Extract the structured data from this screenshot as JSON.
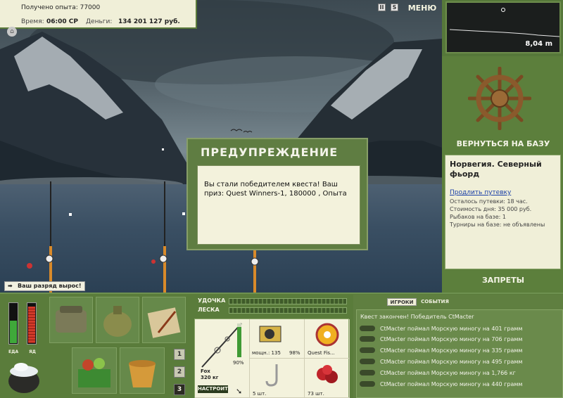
{
  "info": {
    "experience_text": "Получено опыта: 77000",
    "time_label": "Время:",
    "time_value": "06:00 СР",
    "money_label": "Деньги:",
    "money_value": "134 201 127 руб."
  },
  "top_controls": {
    "pause_label": "II",
    "sound_label": "S",
    "menu_label": "МЕНЮ"
  },
  "depth_meter": {
    "depth": "8,04 m"
  },
  "right_panel": {
    "return_label": "ВЕРНУТЬСЯ НА БАЗУ",
    "location_title": "Норвегия. Северный фьорд",
    "extend_link": "Продлить путевку",
    "lines": [
      "Осталось путевки: 18 час.",
      "Стоимость дня: 35 000 руб.",
      "Рыбаков на базе: 1",
      "Турниры на базе: не объявлены"
    ],
    "bans_label": "ЗАПРЕТЫ"
  },
  "dialog": {
    "title": "ПРЕДУПРЕЖДЕНИЕ",
    "message": "Вы стали победителем квеста! Ваш приз: Quest Winners-1, 180000 , Опыта"
  },
  "rank_notice": "Ваш разряд вырос!",
  "gauges": {
    "food_label": "ЕДА",
    "poison_label": "ЯД",
    "food_level": 0.55,
    "poison_level": 0.9
  },
  "inventory_pages": [
    "1",
    "2",
    "3"
  ],
  "tackle": {
    "rod_label": "УДОЧКА",
    "line_label": "ЛЕСКА",
    "rod_name": "Fox",
    "rod_capacity": "320 кг",
    "rod_percent": "90%",
    "reel_text": "мощн.: 135",
    "reel_percent": "98%",
    "line_name": "Quest Fis...",
    "hook_count": "5 шт.",
    "bait_count": "73 шт.",
    "setup_label": "НАСТРОИТЬ"
  },
  "chat": {
    "tab_players": "ИГРОКИ",
    "tab_events": "СОБЫТИЯ",
    "header": "Квест закончен! Победитель CtMacter",
    "messages": [
      "CtMacter поймал Морскую миногу на 401 грамм",
      "CtMacter поймал Морскую миногу на 706 грамм",
      "CtMacter поймал Морскую миногу на 335 грамм",
      "CtMacter поймал Морскую миногу на 495 грамм",
      "CtMacter поймал Морскую миногу на 1,766 кг",
      "CtMacter поймал Морскую миногу на 440 грамм"
    ]
  },
  "colors": {
    "panel_green": "#5c7f3c",
    "cream": "#f0efd8",
    "link_blue": "#1a3fa8"
  }
}
